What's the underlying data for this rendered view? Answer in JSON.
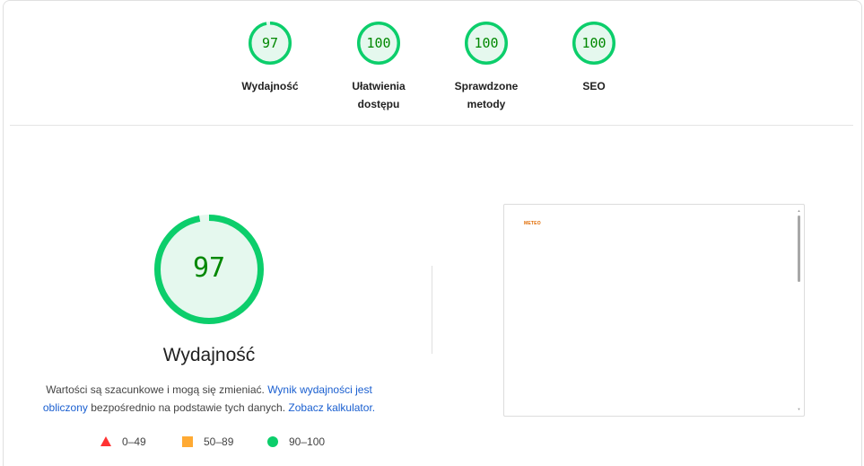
{
  "colors": {
    "pass": "#0cce6b",
    "pass_text": "#008800",
    "pass_fill": "#e5f8ee",
    "average": "#ffaa33",
    "fail": "#ff3333",
    "link": "#1a5fd0"
  },
  "categories": [
    {
      "score": "97",
      "score_value": 97,
      "label": "Wydajność"
    },
    {
      "score": "100",
      "score_value": 100,
      "label": "Ułatwienia dostępu"
    },
    {
      "score": "100",
      "score_value": 100,
      "label": "Sprawdzone metody"
    },
    {
      "score": "100",
      "score_value": 100,
      "label": "SEO"
    }
  ],
  "main": {
    "score": "97",
    "score_value": 97,
    "title": "Wydajność",
    "desc_prefix": "Wartości są szacunkowe i mogą się zmieniać. ",
    "desc_link1": "Wynik wydajności jest obliczony",
    "desc_middle": " bezpośrednio na podstawie tych danych. ",
    "desc_link2": "Zobacz kalkulator."
  },
  "legend": {
    "fail": "0–49",
    "average": "50–89",
    "pass": "90–100"
  },
  "preview": {
    "logo_text": "METEO"
  }
}
